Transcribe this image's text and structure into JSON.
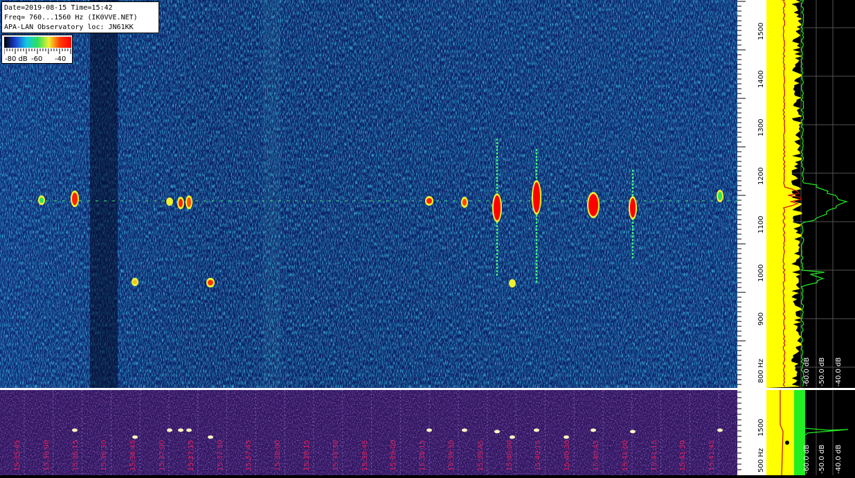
{
  "header": {
    "line1": "Date=2019-08-15 Time=15:42",
    "line2": "Freq= 760...1560 Hz (IK0VVE.NET)",
    "line3": "APA-LAN Observatory loc: JN61KK"
  },
  "legend": {
    "labels": [
      "-80 dB",
      "-60",
      "-40"
    ],
    "gradient": [
      "#000000",
      "#1a3fd1",
      "#14c8e6",
      "#2fe05a",
      "#f0f030",
      "#ff3a00",
      "#ff0000"
    ]
  },
  "freq_scale_top": {
    "labels": [
      "1500",
      "1400",
      "1300",
      "1200",
      "1100",
      "1000",
      "900",
      "800 Hz"
    ]
  },
  "freq_scale_bottom": {
    "labels": [
      "1500",
      "500 Hz"
    ]
  },
  "spectrum_top_db_labels": [
    "-60.0 dB",
    "-50.0 dB",
    "-40.0 dB"
  ],
  "spectrum_bottom_db_labels": [
    "-60.0 dB",
    "-50.0 dB",
    "-40.0 dB"
  ],
  "time_labels": [
    "15:35:45",
    "15:36:00",
    "15:36:15",
    "15:36:30",
    "15:36:45",
    "15:37:00",
    "15:37:15",
    "15:37:30",
    "15:37:45",
    "15:38:00",
    "15:38:15",
    "15:38:30",
    "15:38:45",
    "15:39:00",
    "15:39:15",
    "15:39:30",
    "15:39:45",
    "15:40:00",
    "15:40:15",
    "15:40:30",
    "15:40:45",
    "15:41:00",
    "15:41:15",
    "15:41:30",
    "15:41:45"
  ],
  "colors": {
    "waterfall_bg": "#0a1f5c",
    "bottom_bg": "#3a1a70",
    "spectrum_yellow": "#ffff00",
    "spectrum_green": "#22ee22",
    "spectrum_red": "#cc1111",
    "time_label": "#e0205a"
  }
}
